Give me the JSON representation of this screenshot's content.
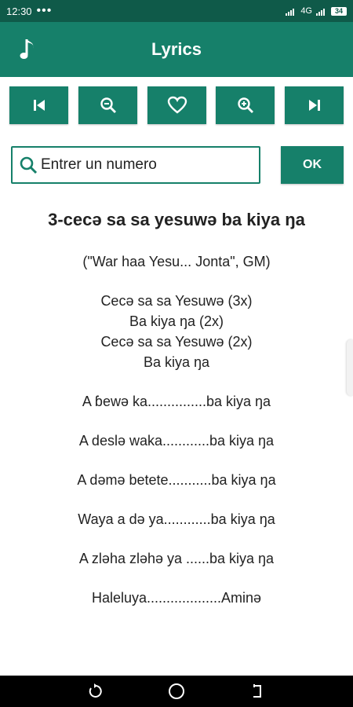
{
  "status_bar": {
    "time": "12:30",
    "dots": "•••",
    "network": "4G",
    "battery": "34"
  },
  "app_bar": {
    "title": "Lyrics",
    "icon": "music-note-icon"
  },
  "toolbar": {
    "buttons": [
      {
        "name": "previous",
        "icon": "skip-previous-icon"
      },
      {
        "name": "zoom-out",
        "icon": "zoom-out-icon"
      },
      {
        "name": "favorite",
        "icon": "heart-outline-icon"
      },
      {
        "name": "zoom-in",
        "icon": "zoom-in-icon"
      },
      {
        "name": "next",
        "icon": "skip-next-icon"
      }
    ]
  },
  "search": {
    "placeholder": "Entrer un numero",
    "value": "",
    "ok_label": "OK"
  },
  "song": {
    "title": "3-cecə sa sa yesuwə ba kiya ŋa",
    "blocks": [
      [
        "(\"War haa Yesu... Jonta\", GM)"
      ],
      [
        "Cecə sa sa Yesuwə (3x)",
        "Ba kiya ŋa (2x)",
        "Cecə sa sa Yesuwə (2x)",
        "Ba kiya ŋa"
      ],
      [
        "A ɓewə ka...............ba kiya ŋa"
      ],
      [
        "A deslə waka............ba kiya ŋa"
      ],
      [
        "A dəmə betete...........ba kiya ŋa"
      ],
      [
        "Waya a də ya............ba kiya ŋa"
      ],
      [
        "A zləha zləhə ya ......ba kiya ŋa"
      ],
      [
        "Haleluya...................Aminə"
      ]
    ]
  },
  "colors": {
    "status_bar": "#0f5a49",
    "primary": "#16806a",
    "text": "#222222"
  }
}
